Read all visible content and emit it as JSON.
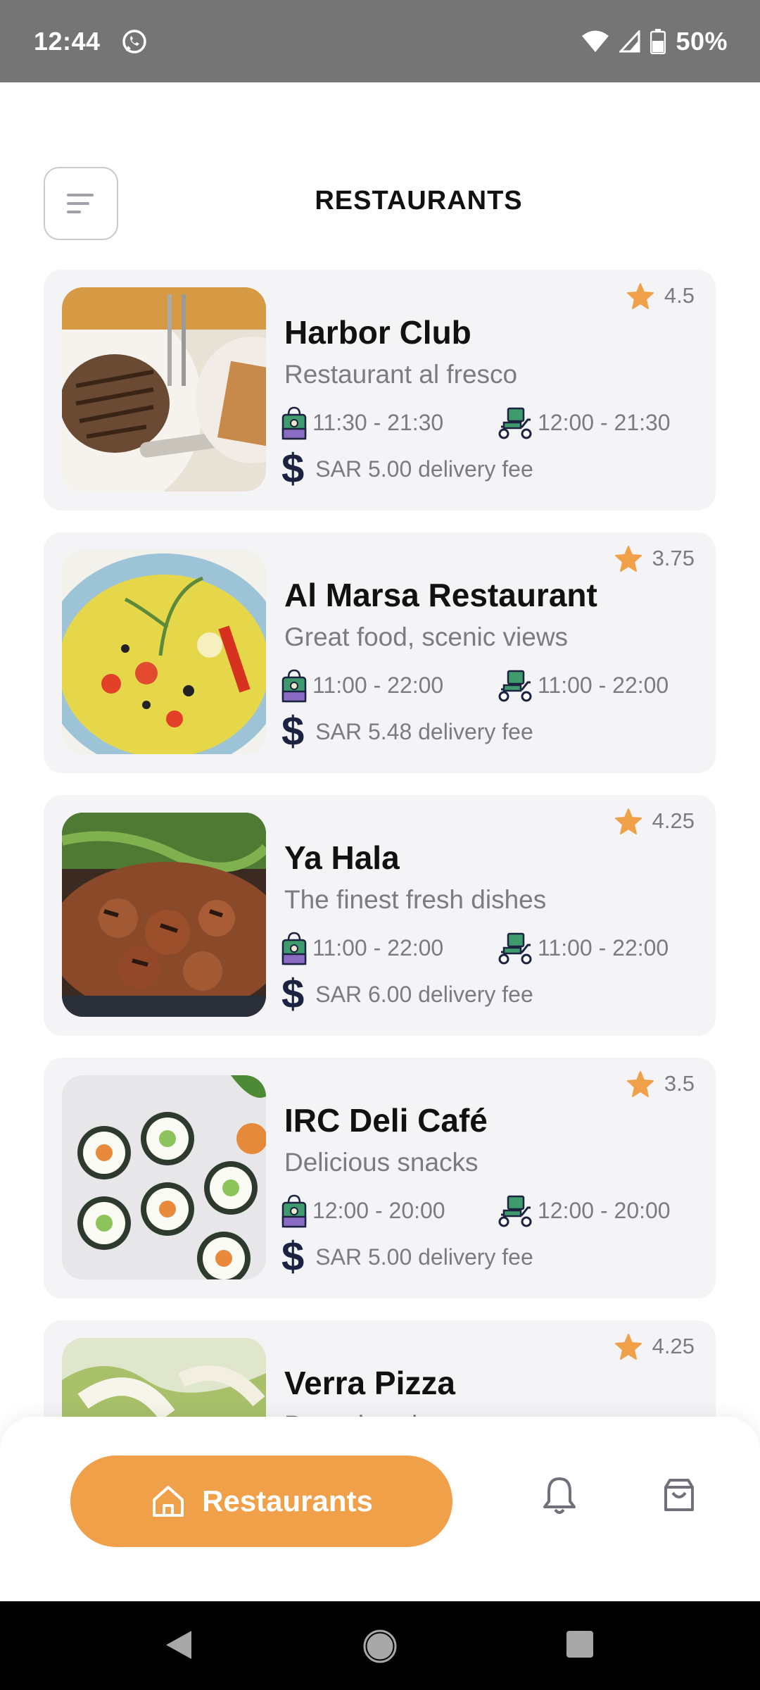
{
  "status_bar": {
    "time": "12:44",
    "battery": "50%"
  },
  "header": {
    "title": "RESTAURANTS"
  },
  "restaurants": [
    {
      "name": "Harbor Club",
      "tagline": "Restaurant al fresco",
      "rating": "4.5",
      "pickup_hours": "11:30 - 21:30",
      "delivery_hours": "12:00 - 21:30",
      "fee": "SAR 5.00 delivery fee",
      "image": "steak"
    },
    {
      "name": "Al Marsa Restaurant",
      "tagline": "Great food, scenic views",
      "rating": "3.75",
      "pickup_hours": "11:00 - 22:00",
      "delivery_hours": "11:00 - 22:00",
      "fee": "SAR 5.48 delivery fee",
      "image": "rice"
    },
    {
      "name": "Ya Hala",
      "tagline": "The finest fresh dishes",
      "rating": "4.25",
      "pickup_hours": "11:00 - 22:00",
      "delivery_hours": "11:00 - 22:00",
      "fee": "SAR 6.00 delivery fee",
      "image": "grill"
    },
    {
      "name": "IRC Deli Café",
      "tagline": "Delicious snacks",
      "rating": "3.5",
      "pickup_hours": "12:00 - 20:00",
      "delivery_hours": "12:00 - 20:00",
      "fee": "SAR 5.00 delivery fee",
      "image": "sushi"
    },
    {
      "name": "Verra Pizza",
      "tagline": "Best pizza in town",
      "rating": "4.25",
      "pickup_hours": "",
      "delivery_hours": "",
      "fee": "",
      "image": "salad"
    }
  ],
  "bottom_nav": {
    "active_label": "Restaurants"
  },
  "colors": {
    "accent": "#f0a048",
    "star": "#f0a048",
    "card_bg": "#f4f4f6",
    "status_bar": "#757575"
  },
  "icons": [
    "whatsapp-icon",
    "wifi-icon",
    "signal-icon",
    "battery-icon",
    "menu-icon",
    "star-icon",
    "pickup-icon",
    "delivery-scooter-icon",
    "dollar-icon",
    "home-icon",
    "bell-icon",
    "shopping-bag-icon"
  ]
}
